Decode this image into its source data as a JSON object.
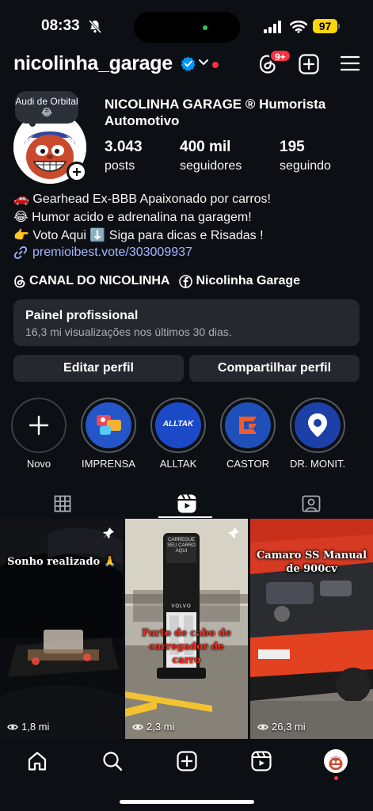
{
  "status_bar": {
    "time": "08:33",
    "battery": "97"
  },
  "header": {
    "username": "nicolinha_garage",
    "threads_badge": "9+"
  },
  "profile": {
    "note": "Audi de Orbital 😂",
    "display_name": "NICOLINHA GARAGE ®  Humorista Automotivo",
    "stats": [
      {
        "value": "3.043",
        "label": "posts"
      },
      {
        "value": "400 mil",
        "label": "seguidores"
      },
      {
        "value": "195",
        "label": "seguindo"
      }
    ],
    "bio": [
      "🚗 Gearhead Ex-BBB Apaixonado por carros!",
      "😂 Humor acido e adrenalina na garagem!",
      "👉 Voto Aqui ⬇️ Siga para dicas e Risadas !"
    ],
    "link": "premioibest.vote/303009937",
    "channels": [
      "CANAL DO NICOLINHA",
      "Nicolinha Garage"
    ]
  },
  "pro_panel": {
    "title": "Painel profissional",
    "subtitle": "16,3 mi visualizações nos últimos 30 dias."
  },
  "buttons": {
    "edit": "Editar perfil",
    "share": "Compartilhar perfil"
  },
  "highlights": [
    {
      "label": "Novo"
    },
    {
      "label": "IMPRENSA"
    },
    {
      "label": "ALLTAK",
      "logo_text": "ALLTAK"
    },
    {
      "label": "CASTOR"
    },
    {
      "label": "DR. MONIT..."
    }
  ],
  "grid": [
    {
      "caption": "Sonho realizado 🙏",
      "views": "1,8 mi"
    },
    {
      "caption": "Furto de cabo de carregador de carro",
      "views": "2,3 mi",
      "charger_text": "CARREGUE SEU CARRO AQUI",
      "brand": "VOLVO"
    },
    {
      "caption": "Camaro SS Manual de 900cv",
      "views": "26,3 mi"
    }
  ],
  "colors": {
    "background": "#0c0f14",
    "surface": "#25292f",
    "link": "#a3b7ff",
    "notification": "#ff3040",
    "verified": "#0095f6"
  }
}
